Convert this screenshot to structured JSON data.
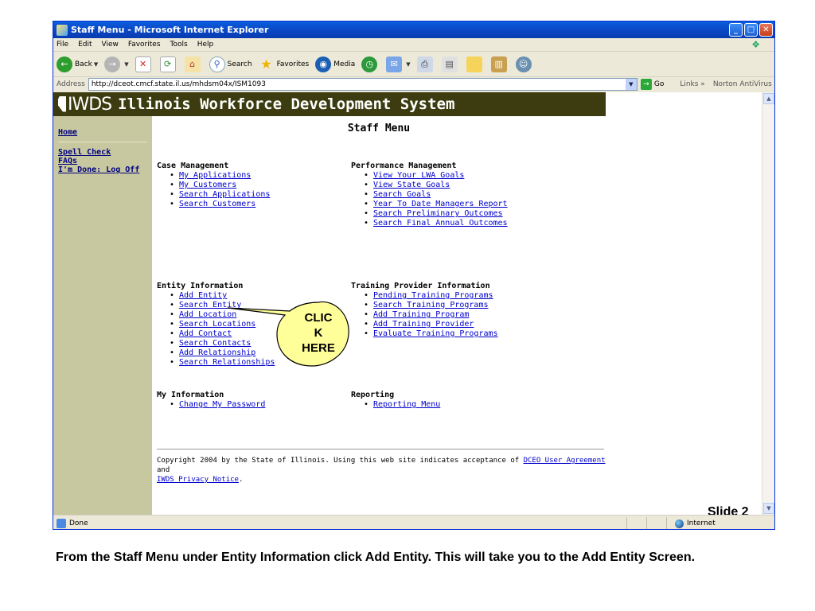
{
  "window": {
    "title": "Staff Menu - Microsoft Internet Explorer",
    "buttons": {
      "minimize": "_",
      "maximize": "□",
      "close": "✕"
    }
  },
  "menubar": [
    "File",
    "Edit",
    "View",
    "Favorites",
    "Tools",
    "Help"
  ],
  "toolbar": {
    "back": "Back",
    "search": "Search",
    "favorites": "Favorites",
    "media": "Media"
  },
  "addressbar": {
    "label": "Address",
    "url": "http://dceot.cmcf.state.il.us/mhdsm04x/ISM1093",
    "go": "Go",
    "links": "Links »",
    "norton": "Norton AntiVirus"
  },
  "banner": {
    "logo": "IWDS",
    "title": "Illinois Workforce Development System"
  },
  "leftnav": {
    "home": "Home",
    "items": [
      "Spell Check",
      "FAQs",
      "I'm Done: Log Off"
    ]
  },
  "main": {
    "title": "Staff Menu",
    "case_management": {
      "heading": "Case Management",
      "links": [
        "My Applications",
        "My Customers",
        "Search Applications",
        "Search Customers"
      ]
    },
    "performance_management": {
      "heading": "Performance Management",
      "links": [
        "View Your LWA Goals",
        "View State Goals",
        "Search Goals",
        "Year To Date Managers Report",
        "Search Preliminary Outcomes",
        "Search Final Annual Outcomes"
      ]
    },
    "entity_information": {
      "heading": "Entity Information",
      "links": [
        "Add Entity",
        "Search Entity",
        "Add Location",
        "Search Locations",
        "Add Contact",
        "Search Contacts",
        "Add Relationship",
        "Search Relationships"
      ]
    },
    "training_provider": {
      "heading": "Training Provider Information",
      "links": [
        "Pending Training Programs",
        "Search Training Programs",
        "Add Training Program",
        "Add Training Provider",
        "Evaluate Training Programs"
      ]
    },
    "my_information": {
      "heading": "My Information",
      "links": [
        "Change My Password"
      ]
    },
    "reporting": {
      "heading": "Reporting",
      "links": [
        "Reporting Menu"
      ]
    },
    "copyright": {
      "text_before": "Copyright 2004 by the State of Illinois. Using this web site indicates acceptance of ",
      "agreement_link": "DCEO User Agreement",
      "text_and": " and",
      "privacy_link": "IWDS Privacy Notice",
      "text_end": "."
    }
  },
  "statusbar": {
    "status": "Done",
    "zone": "Internet"
  },
  "slide": {
    "label": "Slide  2"
  },
  "callout": {
    "line1": "CLIC",
    "line2": "K",
    "line3": "HERE"
  },
  "caption": "From the Staff Menu under Entity Information click Add Entity.  This will take you to the Add Entity Screen."
}
